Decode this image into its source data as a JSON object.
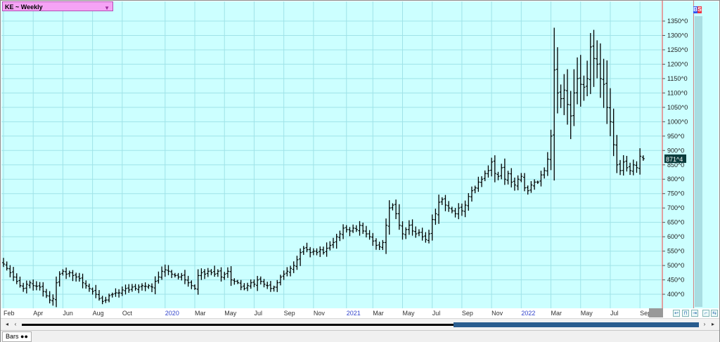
{
  "window": {
    "symbol_title": "KE ~ Weekly",
    "bs_badge": [
      "B",
      "S"
    ],
    "last_price_label": "871^4",
    "status_tab": "Bars ●●"
  },
  "colors": {
    "plot_bg": "#ccffff",
    "bars": "#000000",
    "grid": "#9fe3e8",
    "separator": "#e04040",
    "price_tag_bg": "#0b3d3d",
    "year_label": "#3344cc",
    "title_bg": "#f5a3f5"
  },
  "chart_data": {
    "type": "ohlc",
    "title": "KE ~ Weekly",
    "xlabel": "",
    "ylabel": "",
    "ylim": [
      355,
      1400
    ],
    "y_ticks": [
      "1350^0",
      "1300^0",
      "1250^0",
      "1200^0",
      "1150^0",
      "1100^0",
      "1050^0",
      "1000^0",
      "950^0",
      "900^0",
      "850^0",
      "800^0",
      "750^0",
      "700^0",
      "650^0",
      "600^0",
      "550^0",
      "500^0",
      "450^0",
      "400^0"
    ],
    "y_tick_values": [
      1350,
      1300,
      1250,
      1200,
      1150,
      1100,
      1050,
      1000,
      950,
      900,
      850,
      800,
      750,
      700,
      650,
      600,
      550,
      500,
      450,
      400
    ],
    "x_ticks": [
      {
        "label": "Feb",
        "year": false,
        "week": 0
      },
      {
        "label": "Apr",
        "year": false,
        "week": 9
      },
      {
        "label": "Jun",
        "year": false,
        "week": 18
      },
      {
        "label": "Aug",
        "year": false,
        "week": 27
      },
      {
        "label": "Oct",
        "year": false,
        "week": 36
      },
      {
        "label": "2020",
        "year": true,
        "week": 49
      },
      {
        "label": "Mar",
        "year": false,
        "week": 58
      },
      {
        "label": "May",
        "year": false,
        "week": 67
      },
      {
        "label": "Jul",
        "year": false,
        "week": 76
      },
      {
        "label": "Sep",
        "year": false,
        "week": 85
      },
      {
        "label": "Nov",
        "year": false,
        "week": 94
      },
      {
        "label": "2021",
        "year": true,
        "week": 104
      },
      {
        "label": "Mar",
        "year": false,
        "week": 112
      },
      {
        "label": "May",
        "year": false,
        "week": 121
      },
      {
        "label": "Jul",
        "year": false,
        "week": 130
      },
      {
        "label": "Sep",
        "year": false,
        "week": 139
      },
      {
        "label": "Nov",
        "year": false,
        "week": 148
      },
      {
        "label": "2022",
        "year": true,
        "week": 157
      },
      {
        "label": "Mar",
        "year": false,
        "week": 166
      },
      {
        "label": "May",
        "year": false,
        "week": 175
      },
      {
        "label": "Jul",
        "year": false,
        "week": 184
      },
      {
        "label": "Sep",
        "year": false,
        "week": 193
      }
    ],
    "last_value": 871.5,
    "grid": true,
    "close_path": [
      [
        0,
        505
      ],
      [
        1,
        490
      ],
      [
        2,
        475
      ],
      [
        3,
        460
      ],
      [
        4,
        445
      ],
      [
        5,
        430
      ],
      [
        6,
        420
      ],
      [
        7,
        435
      ],
      [
        8,
        440
      ],
      [
        9,
        430
      ],
      [
        10,
        428
      ],
      [
        11,
        425
      ],
      [
        12,
        410
      ],
      [
        13,
        395
      ],
      [
        14,
        380
      ],
      [
        15,
        385
      ],
      [
        16,
        440
      ],
      [
        17,
        470
      ],
      [
        18,
        480
      ],
      [
        19,
        470
      ],
      [
        20,
        475
      ],
      [
        21,
        465
      ],
      [
        22,
        460
      ],
      [
        23,
        455
      ],
      [
        24,
        440
      ],
      [
        25,
        430
      ],
      [
        26,
        420
      ],
      [
        27,
        410
      ],
      [
        28,
        400
      ],
      [
        29,
        385
      ],
      [
        30,
        375
      ],
      [
        31,
        380
      ],
      [
        32,
        395
      ],
      [
        33,
        400
      ],
      [
        34,
        405
      ],
      [
        35,
        405
      ],
      [
        36,
        415
      ],
      [
        37,
        420
      ],
      [
        38,
        415
      ],
      [
        39,
        425
      ],
      [
        40,
        420
      ],
      [
        41,
        425
      ],
      [
        42,
        430
      ],
      [
        43,
        428
      ],
      [
        44,
        430
      ],
      [
        45,
        425
      ],
      [
        46,
        445
      ],
      [
        47,
        460
      ],
      [
        48,
        480
      ],
      [
        49,
        485
      ],
      [
        50,
        480
      ],
      [
        51,
        470
      ],
      [
        52,
        465
      ],
      [
        53,
        460
      ],
      [
        54,
        465
      ],
      [
        55,
        450
      ],
      [
        56,
        440
      ],
      [
        57,
        430
      ],
      [
        58,
        420
      ],
      [
        59,
        465
      ],
      [
        60,
        475
      ],
      [
        61,
        470
      ],
      [
        62,
        480
      ],
      [
        63,
        475
      ],
      [
        64,
        470
      ],
      [
        65,
        480
      ],
      [
        66,
        460
      ],
      [
        67,
        470
      ],
      [
        68,
        480
      ],
      [
        69,
        450
      ],
      [
        70,
        445
      ],
      [
        71,
        440
      ],
      [
        72,
        425
      ],
      [
        73,
        420
      ],
      [
        74,
        430
      ],
      [
        75,
        440
      ],
      [
        76,
        435
      ],
      [
        77,
        450
      ],
      [
        78,
        445
      ],
      [
        79,
        435
      ],
      [
        80,
        430
      ],
      [
        81,
        420
      ],
      [
        82,
        425
      ],
      [
        83,
        440
      ],
      [
        84,
        460
      ],
      [
        85,
        470
      ],
      [
        86,
        480
      ],
      [
        87,
        490
      ],
      [
        88,
        500
      ],
      [
        89,
        520
      ],
      [
        90,
        545
      ],
      [
        91,
        560
      ],
      [
        92,
        555
      ],
      [
        93,
        545
      ],
      [
        94,
        550
      ],
      [
        95,
        545
      ],
      [
        96,
        555
      ],
      [
        97,
        545
      ],
      [
        98,
        560
      ],
      [
        99,
        570
      ],
      [
        100,
        580
      ],
      [
        101,
        600
      ],
      [
        102,
        610
      ],
      [
        103,
        630
      ],
      [
        104,
        625
      ],
      [
        105,
        620
      ],
      [
        106,
        630
      ],
      [
        107,
        625
      ],
      [
        108,
        640
      ],
      [
        109,
        620
      ],
      [
        110,
        610
      ],
      [
        111,
        600
      ],
      [
        112,
        585
      ],
      [
        113,
        570
      ],
      [
        114,
        565
      ],
      [
        115,
        580
      ],
      [
        116,
        640
      ],
      [
        117,
        700
      ],
      [
        118,
        710
      ],
      [
        119,
        680
      ],
      [
        120,
        640
      ],
      [
        121,
        610
      ],
      [
        122,
        625
      ],
      [
        123,
        640
      ],
      [
        124,
        620
      ],
      [
        125,
        610
      ],
      [
        126,
        615
      ],
      [
        127,
        600
      ],
      [
        128,
        590
      ],
      [
        129,
        610
      ],
      [
        130,
        660
      ],
      [
        131,
        680
      ],
      [
        132,
        720
      ],
      [
        133,
        730
      ],
      [
        134,
        710
      ],
      [
        135,
        700
      ],
      [
        136,
        690
      ],
      [
        137,
        680
      ],
      [
        138,
        700
      ],
      [
        139,
        690
      ],
      [
        140,
        710
      ],
      [
        141,
        740
      ],
      [
        142,
        760
      ],
      [
        143,
        770
      ],
      [
        144,
        790
      ],
      [
        145,
        800
      ],
      [
        146,
        820
      ],
      [
        147,
        830
      ],
      [
        148,
        860
      ],
      [
        149,
        820
      ],
      [
        150,
        810
      ],
      [
        151,
        840
      ],
      [
        152,
        800
      ],
      [
        153,
        820
      ],
      [
        154,
        790
      ],
      [
        155,
        780
      ],
      [
        156,
        800
      ],
      [
        157,
        810
      ],
      [
        158,
        770
      ],
      [
        159,
        760
      ],
      [
        160,
        780
      ],
      [
        161,
        790
      ],
      [
        162,
        790
      ],
      [
        163,
        815
      ],
      [
        164,
        830
      ],
      [
        165,
        870
      ],
      [
        166,
        950
      ],
      [
        167,
        1180
      ],
      [
        168,
        1100
      ],
      [
        169,
        1080
      ],
      [
        170,
        1110
      ],
      [
        171,
        1060
      ],
      [
        172,
        1020
      ],
      [
        173,
        1100
      ],
      [
        174,
        1150
      ],
      [
        175,
        1130
      ],
      [
        176,
        1120
      ],
      [
        177,
        1150
      ],
      [
        178,
        1260
      ],
      [
        179,
        1220
      ],
      [
        180,
        1200
      ],
      [
        181,
        1150
      ],
      [
        182,
        1130
      ],
      [
        183,
        1050
      ],
      [
        184,
        1000
      ],
      [
        185,
        920
      ],
      [
        186,
        850
      ],
      [
        187,
        830
      ],
      [
        188,
        860
      ],
      [
        189,
        840
      ],
      [
        190,
        830
      ],
      [
        191,
        850
      ],
      [
        192,
        840
      ],
      [
        193,
        880
      ],
      [
        194,
        871.5
      ]
    ]
  }
}
